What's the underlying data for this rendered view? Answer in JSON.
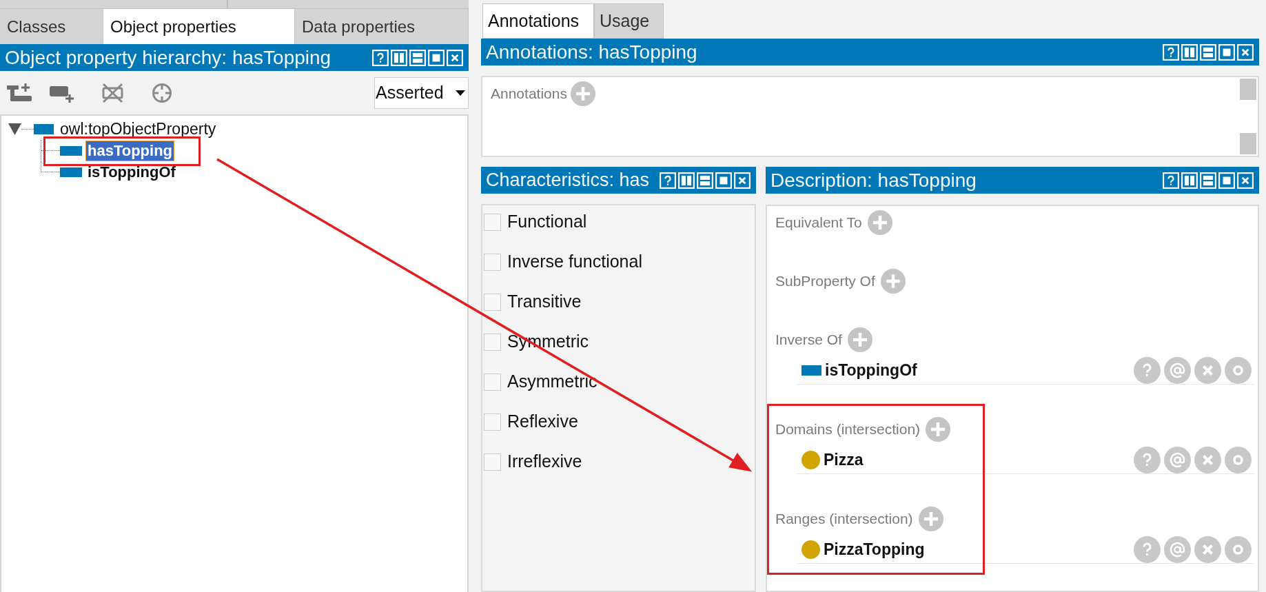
{
  "left_tabs": [
    {
      "label": "Classes",
      "selected": false
    },
    {
      "label": "Object properties",
      "selected": true
    },
    {
      "label": "Data properties",
      "selected": false
    }
  ],
  "hierarchy_panel": {
    "title": "Object property hierarchy: hasTopping",
    "view_select": {
      "value": "Asserted"
    },
    "tree": [
      {
        "label": "owl:topObjectProperty",
        "expanded": true,
        "selected": false,
        "children": [
          {
            "label": "hasTopping",
            "selected": true
          },
          {
            "label": "isToppingOf",
            "selected": false
          }
        ]
      }
    ]
  },
  "right_tabs": [
    {
      "label": "Annotations",
      "selected": true
    },
    {
      "label": "Usage",
      "selected": false
    }
  ],
  "annotations_panel": {
    "title": "Annotations: hasTopping",
    "label": "Annotations"
  },
  "characteristics_panel": {
    "title": "Characteristics: has",
    "items": [
      {
        "label": "Functional",
        "checked": false
      },
      {
        "label": "Inverse functional",
        "checked": false
      },
      {
        "label": "Transitive",
        "checked": false
      },
      {
        "label": "Symmetric",
        "checked": false
      },
      {
        "label": "Asymmetric",
        "checked": false
      },
      {
        "label": "Reflexive",
        "checked": false
      },
      {
        "label": "Irreflexive",
        "checked": false
      }
    ]
  },
  "description_panel": {
    "title": "Description: hasTopping",
    "sections": [
      {
        "label": "Equivalent To"
      },
      {
        "label": "SubProperty Of"
      },
      {
        "label": "Inverse Of",
        "entries": [
          {
            "label": "isToppingOf",
            "kind": "object-property"
          }
        ]
      },
      {
        "label": "Domains (intersection)",
        "entries": [
          {
            "label": "Pizza",
            "kind": "class"
          }
        ]
      },
      {
        "label": "Ranges (intersection)",
        "entries": [
          {
            "label": "PizzaTopping",
            "kind": "class"
          }
        ]
      }
    ]
  }
}
